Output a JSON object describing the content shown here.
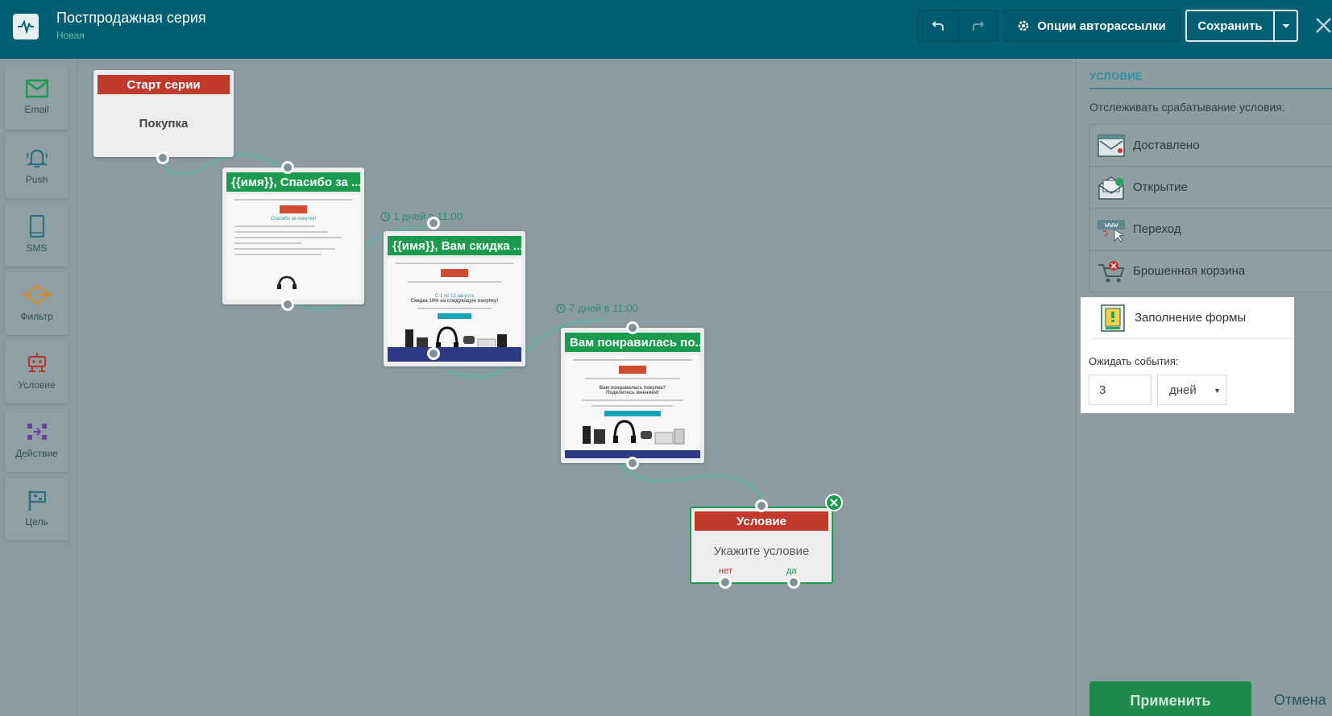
{
  "header": {
    "title": "Постпродажная серия",
    "subtitle": "Новая",
    "options_label": "Опции авторассылки",
    "save_label": "Сохранить"
  },
  "toolbar": {
    "items": [
      {
        "label": "Email",
        "icon": "email-icon",
        "color": "#1a9b4e"
      },
      {
        "label": "Push",
        "icon": "bell-icon",
        "color": "#2c6f80"
      },
      {
        "label": "SMS",
        "icon": "phone-icon",
        "color": "#2c6f80"
      },
      {
        "label": "Фильтр",
        "icon": "filter-icon",
        "color": "#d98a2b"
      },
      {
        "label": "Условие",
        "icon": "robot-icon",
        "color": "#b03a2e"
      },
      {
        "label": "Действие",
        "icon": "action-icon",
        "color": "#6b3fa0"
      },
      {
        "label": "Цель",
        "icon": "flag-icon",
        "color": "#2c6f80"
      }
    ]
  },
  "canvas": {
    "start_node": {
      "header": "Старт серии",
      "body": "Покупка"
    },
    "email_nodes": [
      {
        "title": "{{имя}}, Спасибо за ...",
        "delay": ""
      },
      {
        "title": "{{имя}}, Вам скидка ...",
        "delay": "1 дней в 11:00"
      },
      {
        "title": "Вам понравилась по...",
        "delay": "7 дней в 11:00"
      }
    ],
    "condition_node": {
      "header": "Условие",
      "body": "Укажите условие",
      "no_label": "нет",
      "yes_label": "да"
    }
  },
  "panel": {
    "title": "УСЛОВИЕ",
    "description": "Отслеживать срабатывание условия:",
    "options": [
      {
        "label": "Доставлено",
        "icon": "envelope-delivered-icon"
      },
      {
        "label": "Открытие",
        "icon": "envelope-open-icon"
      },
      {
        "label": "Переход",
        "icon": "www-click-icon"
      },
      {
        "label": "Брошенная корзина",
        "icon": "abandoned-cart-icon"
      },
      {
        "label": "Заполнение формы",
        "icon": "form-fill-icon"
      }
    ],
    "wait_label": "Ожидать события:",
    "wait_value": "3",
    "wait_unit": "дней",
    "apply_label": "Применить",
    "cancel_label": "Отмена"
  }
}
